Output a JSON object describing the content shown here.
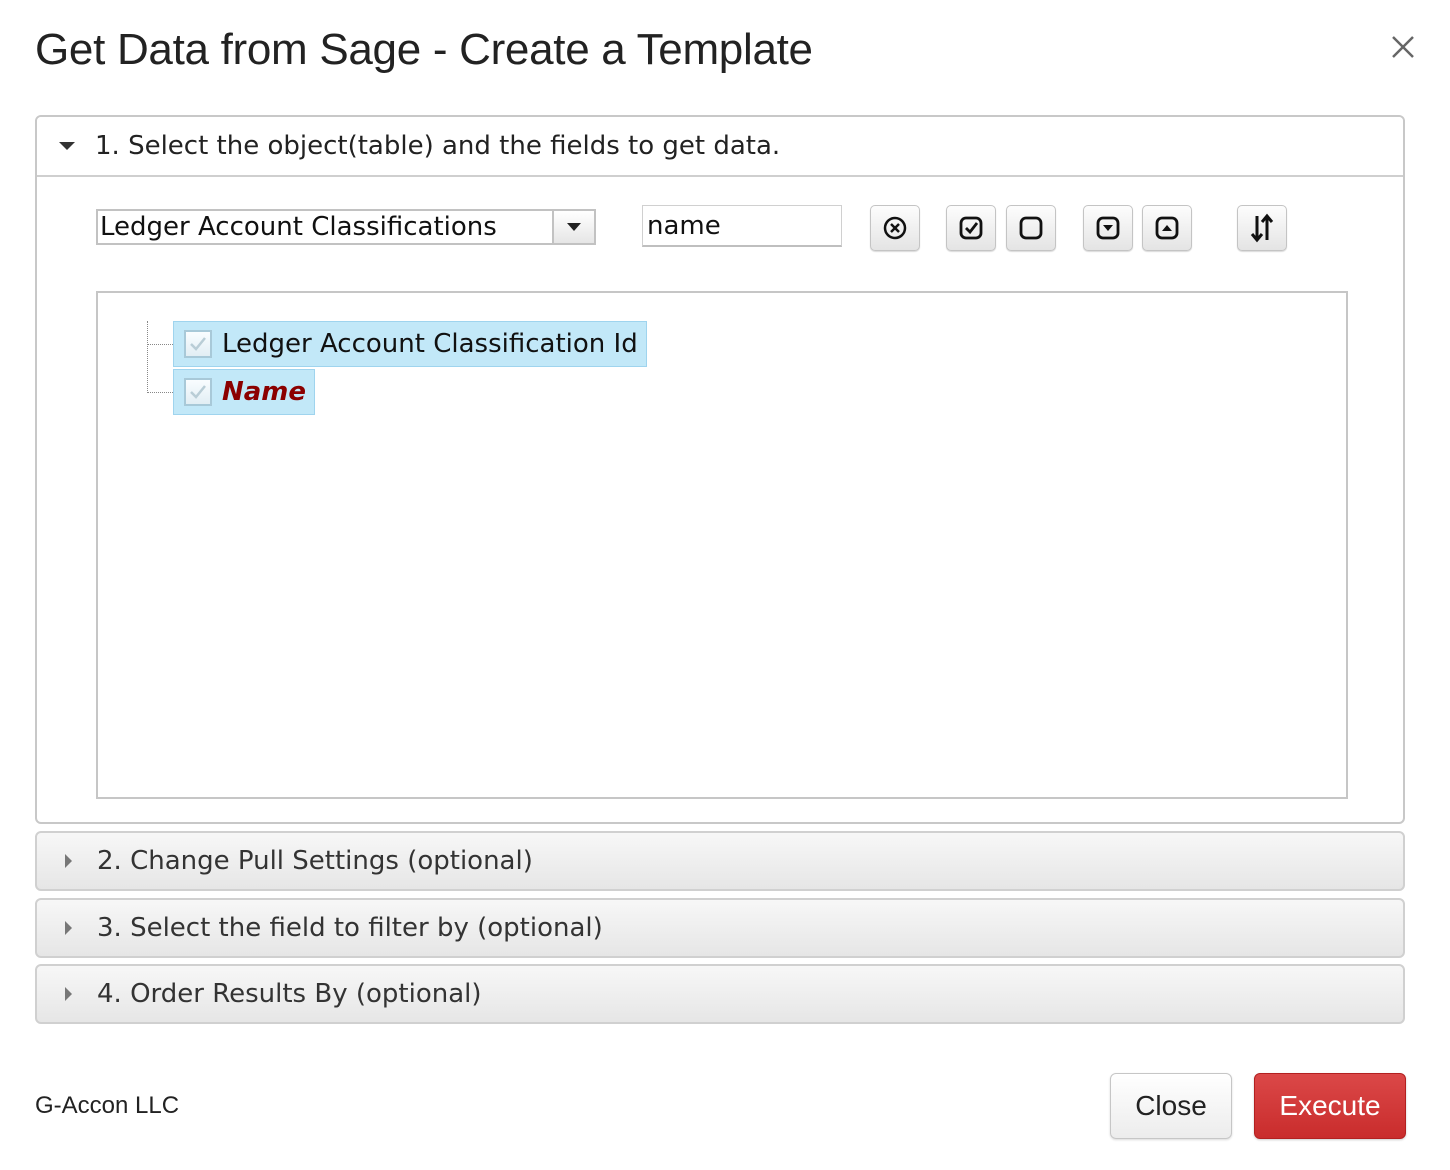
{
  "dialog": {
    "title": "Get Data from Sage - Create a Template",
    "close_icon": "close-icon"
  },
  "section1": {
    "label": "1. Select the object(table) and the fields to get data.",
    "expanded": true,
    "object_select": {
      "value": "Ledger Account Classifications"
    },
    "field_search": {
      "value": "name"
    },
    "toolbar": [
      {
        "name": "clear-search-button",
        "icon": "circle-x-icon"
      },
      {
        "name": "select-all-button",
        "icon": "square-check-icon"
      },
      {
        "name": "deselect-all-button",
        "icon": "square-icon"
      },
      {
        "name": "expand-all-button",
        "icon": "square-chevron-down-icon"
      },
      {
        "name": "collapse-all-button",
        "icon": "square-chevron-up-icon"
      },
      {
        "name": "sort-button",
        "icon": "sort-arrows-icon"
      }
    ],
    "tree": [
      {
        "label": "Ledger Account Classification Id",
        "checked": true,
        "key": false
      },
      {
        "label": "Name",
        "checked": true,
        "key": true
      }
    ]
  },
  "sections": [
    {
      "label": "2. Change Pull Settings (optional)",
      "expanded": false
    },
    {
      "label": "3. Select the field to filter by (optional)",
      "expanded": false
    },
    {
      "label": "4. Order Results By (optional)",
      "expanded": false
    }
  ],
  "footer": {
    "company": "G-Accon LLC",
    "close_label": "Close",
    "execute_label": "Execute"
  },
  "colors": {
    "execute_button": "#cf3535",
    "tree_node_highlight": "#c2e8f8",
    "key_field_text": "#8b0000"
  }
}
